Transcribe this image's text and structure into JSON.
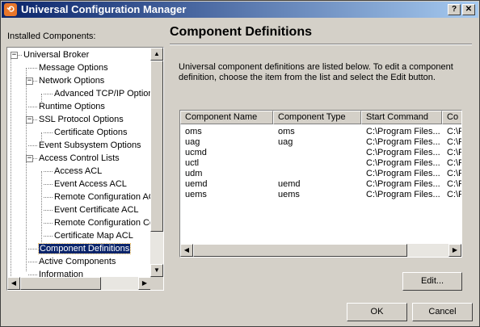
{
  "window": {
    "title": "Universal Configuration Manager",
    "help_button": "?",
    "close_button": "✕"
  },
  "sidebar": {
    "label": "Installed Components:",
    "items": [
      {
        "label": "Universal Broker",
        "expander": "−"
      },
      {
        "label": "Message Options"
      },
      {
        "label": "Network Options",
        "expander": "−"
      },
      {
        "label": "Advanced TCP/IP Options"
      },
      {
        "label": "Runtime Options"
      },
      {
        "label": "SSL Protocol Options",
        "expander": "−"
      },
      {
        "label": "Certificate Options"
      },
      {
        "label": "Event Subsystem Options"
      },
      {
        "label": "Access Control Lists",
        "expander": "−"
      },
      {
        "label": "Access ACL"
      },
      {
        "label": "Event Access ACL"
      },
      {
        "label": "Remote Configuration ACL"
      },
      {
        "label": "Event Certificate ACL"
      },
      {
        "label": "Remote Configuration Certificate ACL"
      },
      {
        "label": "Certificate Map ACL"
      },
      {
        "label": "Component Definitions",
        "selected": true
      },
      {
        "label": "Active Components"
      },
      {
        "label": "Information"
      }
    ]
  },
  "main": {
    "title": "Component Definitions",
    "description": "Universal component definitions are listed below.  To edit a component definition, choose the item from the list and select the Edit button.",
    "columns": [
      "Component Name",
      "Component Type",
      "Start Command",
      "Co"
    ],
    "rows": [
      [
        "oms",
        "oms",
        "C:\\Program Files...",
        "C:\\F"
      ],
      [
        "uag",
        "uag",
        "C:\\Program Files...",
        "C:\\F"
      ],
      [
        "ucmd",
        "",
        "C:\\Program Files...",
        "C:\\F"
      ],
      [
        "uctl",
        "",
        "C:\\Program Files...",
        "C:\\F"
      ],
      [
        "udm",
        "",
        "C:\\Program Files...",
        "C:\\F"
      ],
      [
        "uemd",
        "uemd",
        "C:\\Program Files...",
        "C:\\F"
      ],
      [
        "uems",
        "uems",
        "C:\\Program Files...",
        "C:\\F"
      ]
    ],
    "edit_button": "Edit..."
  },
  "footer": {
    "ok": "OK",
    "cancel": "Cancel"
  },
  "icons": {
    "app": "ucm-app-icon",
    "scroll_up": "▲",
    "scroll_down": "▼",
    "scroll_left": "◀",
    "scroll_right": "▶"
  },
  "colors": {
    "titlebar_start": "#0a246a",
    "titlebar_end": "#a6caf0",
    "selection": "#0a246a",
    "face": "#d4d0c8"
  }
}
